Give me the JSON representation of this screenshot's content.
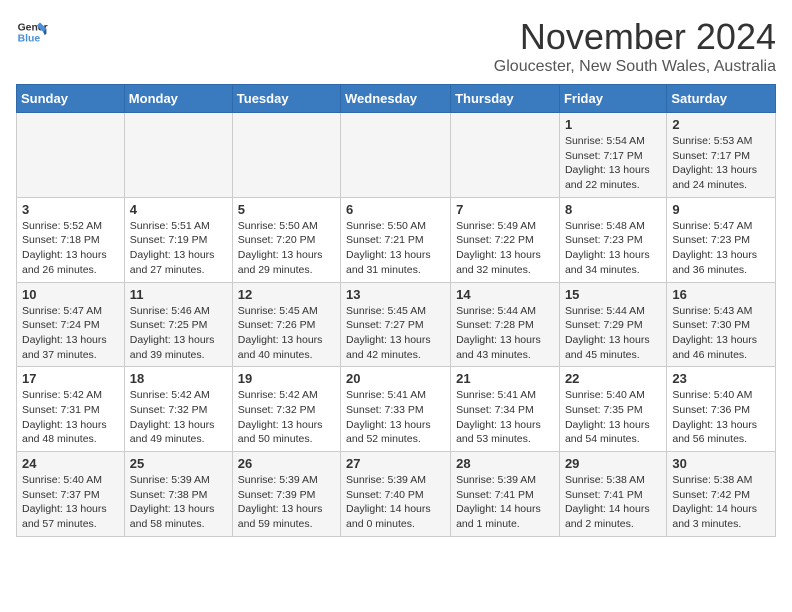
{
  "header": {
    "logo_line1": "General",
    "logo_line2": "Blue",
    "month_title": "November 2024",
    "location": "Gloucester, New South Wales, Australia"
  },
  "days_of_week": [
    "Sunday",
    "Monday",
    "Tuesday",
    "Wednesday",
    "Thursday",
    "Friday",
    "Saturday"
  ],
  "weeks": [
    [
      {
        "day": "",
        "content": ""
      },
      {
        "day": "",
        "content": ""
      },
      {
        "day": "",
        "content": ""
      },
      {
        "day": "",
        "content": ""
      },
      {
        "day": "",
        "content": ""
      },
      {
        "day": "1",
        "content": "Sunrise: 5:54 AM\nSunset: 7:17 PM\nDaylight: 13 hours and 22 minutes."
      },
      {
        "day": "2",
        "content": "Sunrise: 5:53 AM\nSunset: 7:17 PM\nDaylight: 13 hours and 24 minutes."
      }
    ],
    [
      {
        "day": "3",
        "content": "Sunrise: 5:52 AM\nSunset: 7:18 PM\nDaylight: 13 hours and 26 minutes."
      },
      {
        "day": "4",
        "content": "Sunrise: 5:51 AM\nSunset: 7:19 PM\nDaylight: 13 hours and 27 minutes."
      },
      {
        "day": "5",
        "content": "Sunrise: 5:50 AM\nSunset: 7:20 PM\nDaylight: 13 hours and 29 minutes."
      },
      {
        "day": "6",
        "content": "Sunrise: 5:50 AM\nSunset: 7:21 PM\nDaylight: 13 hours and 31 minutes."
      },
      {
        "day": "7",
        "content": "Sunrise: 5:49 AM\nSunset: 7:22 PM\nDaylight: 13 hours and 32 minutes."
      },
      {
        "day": "8",
        "content": "Sunrise: 5:48 AM\nSunset: 7:23 PM\nDaylight: 13 hours and 34 minutes."
      },
      {
        "day": "9",
        "content": "Sunrise: 5:47 AM\nSunset: 7:23 PM\nDaylight: 13 hours and 36 minutes."
      }
    ],
    [
      {
        "day": "10",
        "content": "Sunrise: 5:47 AM\nSunset: 7:24 PM\nDaylight: 13 hours and 37 minutes."
      },
      {
        "day": "11",
        "content": "Sunrise: 5:46 AM\nSunset: 7:25 PM\nDaylight: 13 hours and 39 minutes."
      },
      {
        "day": "12",
        "content": "Sunrise: 5:45 AM\nSunset: 7:26 PM\nDaylight: 13 hours and 40 minutes."
      },
      {
        "day": "13",
        "content": "Sunrise: 5:45 AM\nSunset: 7:27 PM\nDaylight: 13 hours and 42 minutes."
      },
      {
        "day": "14",
        "content": "Sunrise: 5:44 AM\nSunset: 7:28 PM\nDaylight: 13 hours and 43 minutes."
      },
      {
        "day": "15",
        "content": "Sunrise: 5:44 AM\nSunset: 7:29 PM\nDaylight: 13 hours and 45 minutes."
      },
      {
        "day": "16",
        "content": "Sunrise: 5:43 AM\nSunset: 7:30 PM\nDaylight: 13 hours and 46 minutes."
      }
    ],
    [
      {
        "day": "17",
        "content": "Sunrise: 5:42 AM\nSunset: 7:31 PM\nDaylight: 13 hours and 48 minutes."
      },
      {
        "day": "18",
        "content": "Sunrise: 5:42 AM\nSunset: 7:32 PM\nDaylight: 13 hours and 49 minutes."
      },
      {
        "day": "19",
        "content": "Sunrise: 5:42 AM\nSunset: 7:32 PM\nDaylight: 13 hours and 50 minutes."
      },
      {
        "day": "20",
        "content": "Sunrise: 5:41 AM\nSunset: 7:33 PM\nDaylight: 13 hours and 52 minutes."
      },
      {
        "day": "21",
        "content": "Sunrise: 5:41 AM\nSunset: 7:34 PM\nDaylight: 13 hours and 53 minutes."
      },
      {
        "day": "22",
        "content": "Sunrise: 5:40 AM\nSunset: 7:35 PM\nDaylight: 13 hours and 54 minutes."
      },
      {
        "day": "23",
        "content": "Sunrise: 5:40 AM\nSunset: 7:36 PM\nDaylight: 13 hours and 56 minutes."
      }
    ],
    [
      {
        "day": "24",
        "content": "Sunrise: 5:40 AM\nSunset: 7:37 PM\nDaylight: 13 hours and 57 minutes."
      },
      {
        "day": "25",
        "content": "Sunrise: 5:39 AM\nSunset: 7:38 PM\nDaylight: 13 hours and 58 minutes."
      },
      {
        "day": "26",
        "content": "Sunrise: 5:39 AM\nSunset: 7:39 PM\nDaylight: 13 hours and 59 minutes."
      },
      {
        "day": "27",
        "content": "Sunrise: 5:39 AM\nSunset: 7:40 PM\nDaylight: 14 hours and 0 minutes."
      },
      {
        "day": "28",
        "content": "Sunrise: 5:39 AM\nSunset: 7:41 PM\nDaylight: 14 hours and 1 minute."
      },
      {
        "day": "29",
        "content": "Sunrise: 5:38 AM\nSunset: 7:41 PM\nDaylight: 14 hours and 2 minutes."
      },
      {
        "day": "30",
        "content": "Sunrise: 5:38 AM\nSunset: 7:42 PM\nDaylight: 14 hours and 3 minutes."
      }
    ]
  ]
}
